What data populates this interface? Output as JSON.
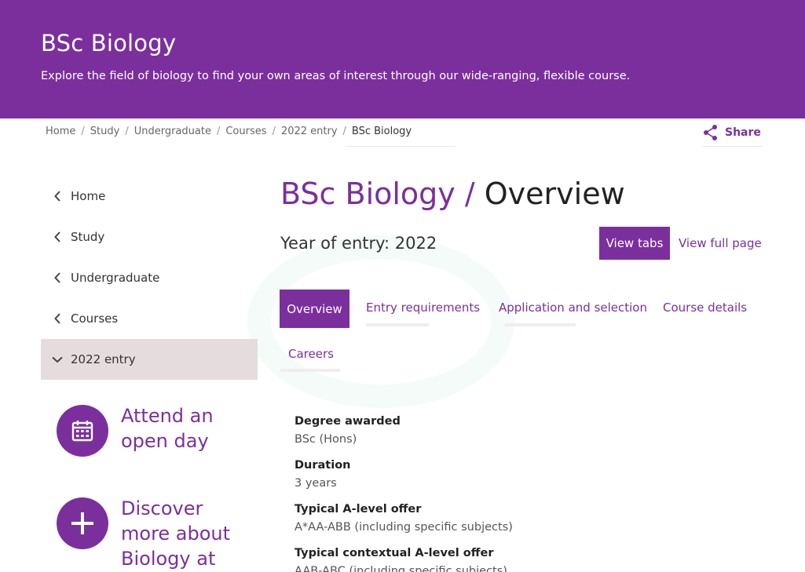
{
  "hero": {
    "title": "BSc Biology",
    "subtitle": "Explore the field of biology to find your own areas of interest through our wide-ranging, flexible course."
  },
  "breadcrumb": {
    "items": [
      "Home",
      "Study",
      "Undergraduate",
      "Courses",
      "2022 entry"
    ],
    "current": "BSc Biology",
    "separator": "/"
  },
  "share": {
    "label": "Share",
    "icon": "share-icon"
  },
  "sidebar": {
    "items": [
      {
        "label": "Home",
        "icon": "chevron-left-icon"
      },
      {
        "label": "Study",
        "icon": "chevron-left-icon"
      },
      {
        "label": "Undergraduate",
        "icon": "chevron-left-icon"
      },
      {
        "label": "Courses",
        "icon": "chevron-left-icon"
      },
      {
        "label": "2022 entry",
        "icon": "chevron-down-icon",
        "active": true
      }
    ]
  },
  "promos": [
    {
      "label": "Attend an open day",
      "icon": "calendar-icon"
    },
    {
      "label": "Discover more about Biology at",
      "icon": "plus-icon"
    }
  ],
  "main": {
    "title_primary": "BSc Biology /",
    "title_secondary": "Overview",
    "year_of_entry": "Year of entry: 2022",
    "view_tabs_label": "View tabs",
    "view_full_page_label": "View full page"
  },
  "tabs": [
    {
      "label": "Overview",
      "active": true
    },
    {
      "label": "Entry requirements"
    },
    {
      "label": "Application and selection"
    },
    {
      "label": "Course details"
    },
    {
      "label": "Careers"
    }
  ],
  "facts": [
    {
      "label": "Degree awarded",
      "value": "BSc (Hons)"
    },
    {
      "label": "Duration",
      "value": "3 years"
    },
    {
      "label": "Typical A-level offer",
      "value": "A*AA-ABB (including specific subjects)"
    },
    {
      "label": "Typical contextual A-level offer",
      "value": "AAB-ABC (including specific subjects)"
    }
  ],
  "colors": {
    "brand": "#7b2f9d",
    "active_sidebar_bg": "#e5dddd"
  }
}
